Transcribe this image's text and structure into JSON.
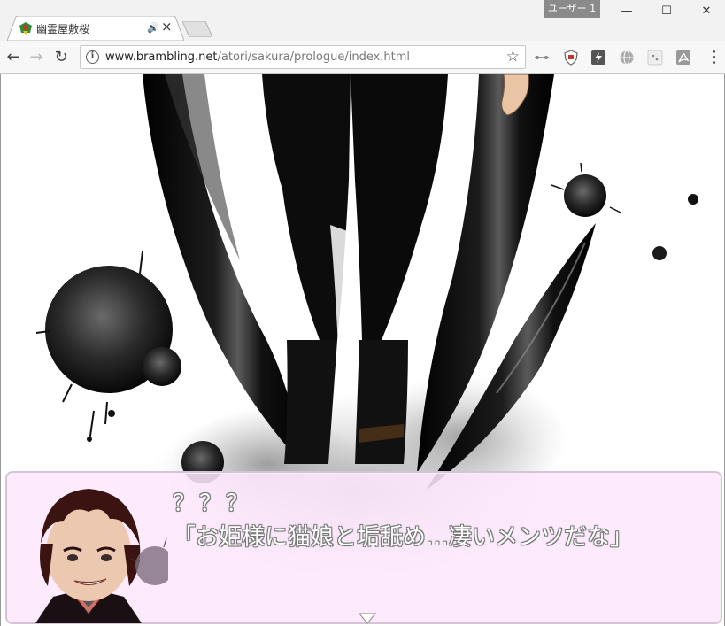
{
  "window": {
    "tab_title": "幽霊屋敷桜",
    "user_badge": "ユーザー 1",
    "minimize_glyph": "—",
    "maximize_glyph": "☐",
    "close_glyph": "✕"
  },
  "toolbar": {
    "url_host": "www.brambling.net",
    "url_path": "/atori/sakura/prologue/index.html",
    "back_glyph": "←",
    "forward_glyph": "→",
    "reload_glyph": "↻",
    "star_glyph": "☆",
    "info_glyph": "i",
    "menu_glyph": "⋮",
    "extensions": [
      "link-extension-icon",
      "shield-extension-icon",
      "bolt-extension-icon",
      "globe-extension-icon",
      "small-extension-icon",
      "pdf-extension-icon"
    ]
  },
  "game": {
    "speaker": "？？？",
    "dialogue": "「お姫様に猫娘と垢舐め…凄いメンツだな」"
  },
  "icons": {
    "tab_close": "×",
    "tab_audio": "🔊"
  },
  "colors": {
    "message_window": "#fde8fd",
    "message_border": "#d6c3d6"
  }
}
